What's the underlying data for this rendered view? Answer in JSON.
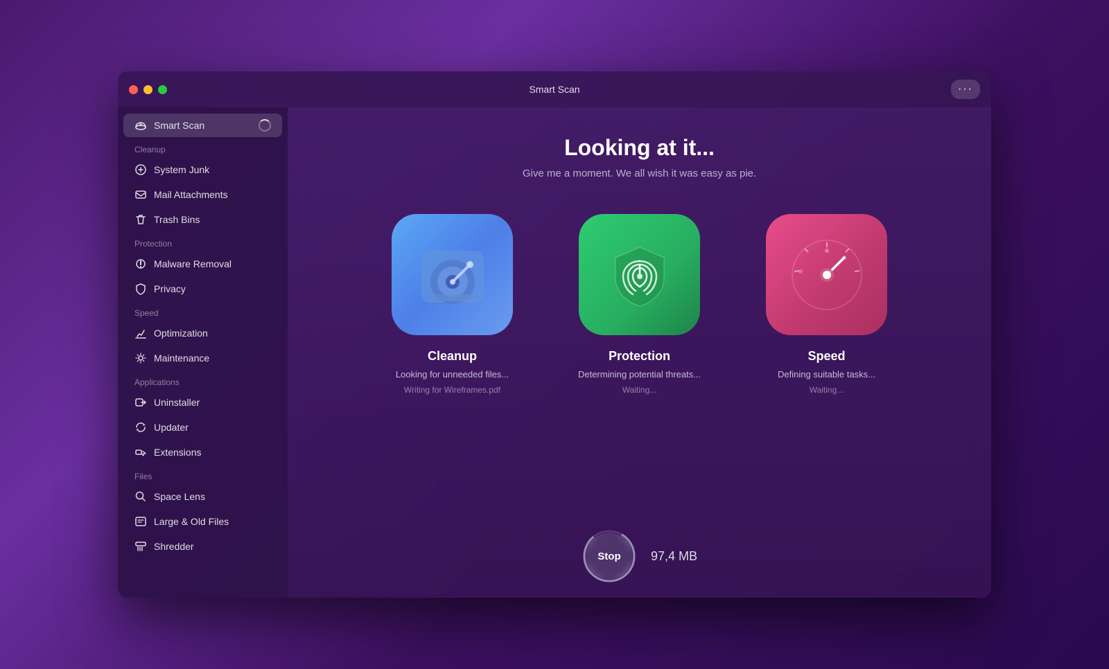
{
  "window": {
    "title": "Smart Scan"
  },
  "sidebar": {
    "smart_scan_label": "Smart Scan",
    "sections": [
      {
        "label": "Cleanup",
        "items": [
          {
            "id": "system-junk",
            "label": "System Junk",
            "icon": "system-junk-icon"
          },
          {
            "id": "mail-attachments",
            "label": "Mail Attachments",
            "icon": "mail-icon"
          },
          {
            "id": "trash-bins",
            "label": "Trash Bins",
            "icon": "trash-icon"
          }
        ]
      },
      {
        "label": "Protection",
        "items": [
          {
            "id": "malware-removal",
            "label": "Malware Removal",
            "icon": "malware-icon"
          },
          {
            "id": "privacy",
            "label": "Privacy",
            "icon": "privacy-icon"
          }
        ]
      },
      {
        "label": "Speed",
        "items": [
          {
            "id": "optimization",
            "label": "Optimization",
            "icon": "optimization-icon"
          },
          {
            "id": "maintenance",
            "label": "Maintenance",
            "icon": "maintenance-icon"
          }
        ]
      },
      {
        "label": "Applications",
        "items": [
          {
            "id": "uninstaller",
            "label": "Uninstaller",
            "icon": "uninstaller-icon"
          },
          {
            "id": "updater",
            "label": "Updater",
            "icon": "updater-icon"
          },
          {
            "id": "extensions",
            "label": "Extensions",
            "icon": "extensions-icon"
          }
        ]
      },
      {
        "label": "Files",
        "items": [
          {
            "id": "space-lens",
            "label": "Space Lens",
            "icon": "space-lens-icon"
          },
          {
            "id": "large-old-files",
            "label": "Large & Old Files",
            "icon": "large-files-icon"
          },
          {
            "id": "shredder",
            "label": "Shredder",
            "icon": "shredder-icon"
          }
        ]
      }
    ]
  },
  "main": {
    "heading": "Looking at it...",
    "subtitle": "Give me a moment. We all wish it was easy as pie.",
    "cards": [
      {
        "id": "cleanup",
        "title": "Cleanup",
        "status": "Looking for unneeded files...",
        "sub_status": "Writing for Wireframes.pdf",
        "type": "cleanup"
      },
      {
        "id": "protection",
        "title": "Protection",
        "status": "Determining potential threats...",
        "sub_status": "Waiting...",
        "type": "protection"
      },
      {
        "id": "speed",
        "title": "Speed",
        "status": "Defining suitable tasks...",
        "sub_status": "Waiting...",
        "type": "speed"
      }
    ],
    "stop_button_label": "Stop",
    "mb_value": "97,4 MB"
  }
}
